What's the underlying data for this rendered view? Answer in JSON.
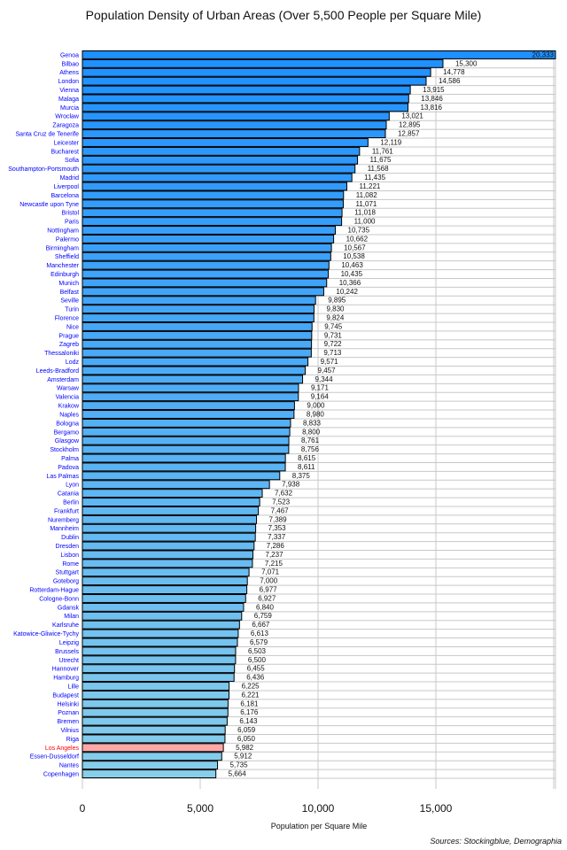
{
  "chart_data": {
    "type": "bar",
    "orientation": "horizontal",
    "title": "Population Density of Urban Areas (Over 5,500 People per Square Mile)",
    "xlabel": "Population per Square Mile",
    "ylabel": "",
    "source": "Sources: Stockingblue, Demographia",
    "xlim": [
      0,
      20000
    ],
    "xticks": [
      0,
      5000,
      10000,
      15000
    ],
    "xtick_labels": [
      "0",
      "5,000",
      "10,000",
      "15,000"
    ],
    "grid": true,
    "legend": "none",
    "colors": {
      "bar_top": "#1e90ff",
      "bar_bottom": "#87ceeb",
      "highlight_bar": "#ffa8a8",
      "label": "#0000ff",
      "highlight_label": "#ff0000",
      "grid": "#c8c8c8"
    },
    "highlight": "Los Angeles",
    "categories": [
      "Genoa",
      "Bilbao",
      "Athens",
      "London",
      "Vienna",
      "Malaga",
      "Murcia",
      "Wroclaw",
      "Zaragoza",
      "Santa Cruz de Tenerife",
      "Leicester",
      "Bucharest",
      "Sofia",
      "Southampton-Portsmouth",
      "Madrid",
      "Liverpool",
      "Barcelona",
      "Newcastle upon Tyne",
      "Bristol",
      "Paris",
      "Nottingham",
      "Palermo",
      "Birmingham",
      "Sheffield",
      "Manchester",
      "Edinburgh",
      "Munich",
      "Belfast",
      "Seville",
      "Turin",
      "Florence",
      "Nice",
      "Prague",
      "Zagreb",
      "Thessaloniki",
      "Lodz",
      "Leeds-Bradford",
      "Amsterdam",
      "Warsaw",
      "Valencia",
      "Krakow",
      "Naples",
      "Bologna",
      "Bergamo",
      "Glasgow",
      "Stockholm",
      "Palma",
      "Padova",
      "Las Palmas",
      "Lyon",
      "Catania",
      "Berlin",
      "Frankfurt",
      "Nuremberg",
      "Mannheim",
      "Dublin",
      "Dresden",
      "Lisbon",
      "Rome",
      "Stuttgart",
      "Goteborg",
      "Rotterdam-Hague",
      "Cologne-Bonn",
      "Gdansk",
      "Milan",
      "Karlsruhe",
      "Katowice-Gliwice-Tychy",
      "Leipzig",
      "Brussels",
      "Utrecht",
      "Hannover",
      "Hamburg",
      "Lille",
      "Budapest",
      "Helsinki",
      "Poznan",
      "Bremen",
      "Vilnius",
      "Riga",
      "Los Angeles",
      "Essen-Dusseldorf",
      "Nantes",
      "Copenhagen"
    ],
    "values": [
      20333,
      15300,
      14778,
      14586,
      13915,
      13846,
      13816,
      13021,
      12895,
      12857,
      12119,
      11761,
      11675,
      11568,
      11435,
      11221,
      11082,
      11071,
      11018,
      11000,
      10735,
      10662,
      10567,
      10538,
      10463,
      10435,
      10366,
      10242,
      9895,
      9830,
      9824,
      9745,
      9731,
      9722,
      9713,
      9571,
      9457,
      9344,
      9171,
      9164,
      9000,
      8980,
      8833,
      8800,
      8761,
      8756,
      8615,
      8611,
      8375,
      7938,
      7632,
      7523,
      7467,
      7389,
      7353,
      7337,
      7286,
      7237,
      7215,
      7071,
      7000,
      6977,
      6927,
      6840,
      6759,
      6667,
      6613,
      6579,
      6503,
      6500,
      6455,
      6436,
      6225,
      6221,
      6181,
      6176,
      6143,
      6059,
      6050,
      5982,
      5912,
      5735,
      5664
    ]
  }
}
